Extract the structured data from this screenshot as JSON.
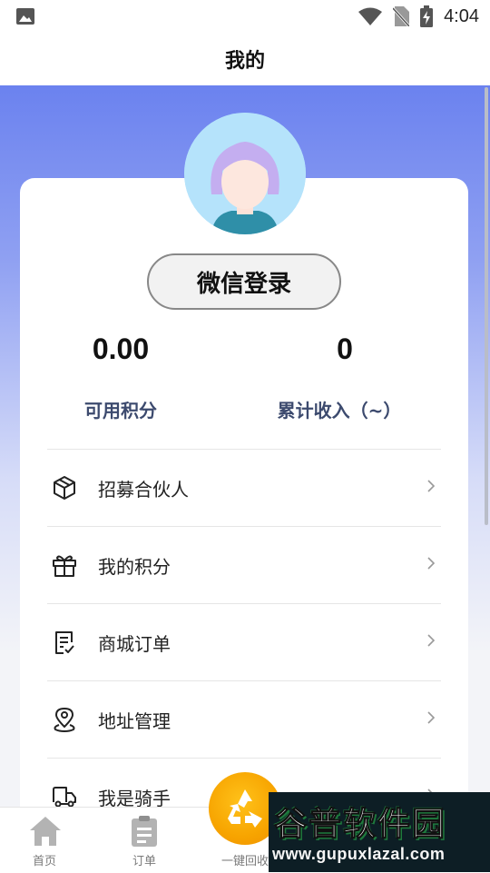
{
  "status_bar": {
    "time": "4:04",
    "icons": [
      "image-icon",
      "wifi-icon",
      "no-sim-icon",
      "battery-charging-icon"
    ]
  },
  "header": {
    "title": "我的"
  },
  "profile": {
    "avatar": "avatar",
    "login_button": "微信登录"
  },
  "stats": [
    {
      "value": "0.00",
      "label": "可用积分"
    },
    {
      "value": "0",
      "label": "累计收入（~）"
    }
  ],
  "menu": [
    {
      "label": "招募合伙人",
      "icon": "box-icon"
    },
    {
      "label": "我的积分",
      "icon": "gift-icon"
    },
    {
      "label": "商城订单",
      "icon": "order-list-icon"
    },
    {
      "label": "地址管理",
      "icon": "location-icon"
    },
    {
      "label": "我是骑手",
      "icon": "delivery-truck-icon"
    }
  ],
  "tabbar": {
    "tabs": [
      {
        "label": "首页",
        "icon": "home-icon"
      },
      {
        "label": "订单",
        "icon": "clipboard-icon"
      },
      {
        "label": "一键回收",
        "icon": "recycle-icon"
      }
    ]
  },
  "watermark": {
    "name": "谷普软件园",
    "url": "www.gupuxlazal.com"
  },
  "colors": {
    "hero_top": "#6b82ef",
    "accent_orange": "#f7a400",
    "label_blue": "#3c4a6e"
  }
}
